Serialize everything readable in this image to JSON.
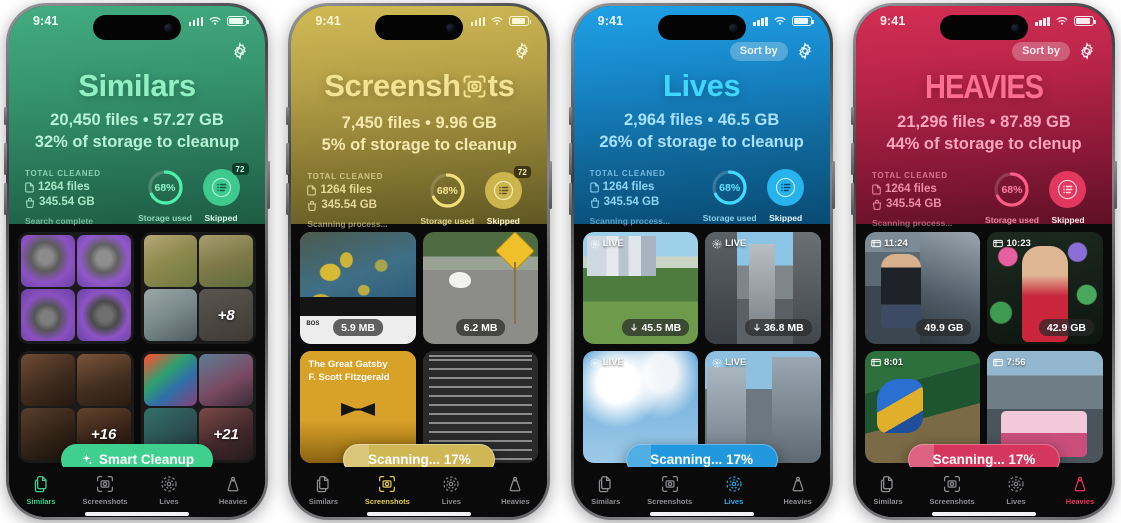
{
  "colors": {
    "green_light": "#3fab7f",
    "green_dark": "#1b5740",
    "gold_light": "#cdb64f",
    "gold_dark": "#6e6326",
    "blue_light": "#1e9ee0",
    "blue_dark": "#0b4f78",
    "red_light": "#d42c52",
    "red_dark": "#7e1430",
    "accent_green": "#34c88a",
    "accent_gold": "#e8d56a",
    "accent_blue": "#2ec5f6",
    "accent_red": "#ff5e86",
    "tab_inactive": "#8e8e93"
  },
  "status_bar": {
    "time": "9:41",
    "signal": "cellular-signal",
    "wifi": "wifi",
    "battery": "battery"
  },
  "tabs": [
    {
      "label": "Similars",
      "icon": "documents-icon"
    },
    {
      "label": "Screenshots",
      "icon": "screenshot-frame-icon"
    },
    {
      "label": "Lives",
      "icon": "live-photo-icon"
    },
    {
      "label": "Heavies",
      "icon": "weight-icon"
    }
  ],
  "common": {
    "kicker": "TOTAL CLEANED",
    "files_cleaned": "1264 files",
    "size_cleaned": "345.54 GB",
    "storage_caption": "Storage used",
    "skipped_caption": "Skipped",
    "storage_percent": "68%",
    "storage_percent_value": 68,
    "skipped_badge": "72",
    "sort_by_label": "Sort by",
    "settings_icon": "gear-icon",
    "file-icon": "file-icon",
    "bag-icon": "cleanup-bag-icon"
  },
  "screens": [
    {
      "id": "similars",
      "title": "Similars",
      "title_style": "plain",
      "stats_line": "20,450 files • 57.27 GB",
      "cleanup_line": "32% of storage to cleanup",
      "left_caption": "Search complete",
      "has_sort_by": false,
      "has_skipped_badge": true,
      "active_tab": 0,
      "action": {
        "label": "Smart Cleanup",
        "icon": "sparkle-icon",
        "type": "button",
        "progress": 0
      },
      "card_type": "quad",
      "cards": [
        {
          "overflow": "",
          "tiles": [
            "#7b4fae",
            "#7e52b1",
            "#6e4aa0",
            "#8457b8"
          ]
        },
        {
          "overflow": "+8",
          "tiles": [
            "#8a7b4a",
            "#7d6f44",
            "#6f7d80",
            "#4a4640"
          ]
        },
        {
          "overflow": "+16",
          "tiles": [
            "#5c3a2c",
            "#6b4536",
            "#4a3024",
            "#56382a"
          ]
        },
        {
          "overflow": "+21",
          "tiles": [
            "#2f7a6a",
            "#7a4a68",
            "#3a6a72",
            "#6b3a52"
          ]
        }
      ]
    },
    {
      "id": "screenshots",
      "title": "Screensh",
      "title_suffix": "ts",
      "title_style": "camera-o",
      "stats_line": "7,450 files • 9.96 GB",
      "cleanup_line": "5% of storage to cleanup",
      "left_caption": "Scanning process...",
      "has_sort_by": false,
      "has_skipped_badge": true,
      "active_tab": 1,
      "action": {
        "label": "Scanning... 17%",
        "icon": "",
        "type": "progress",
        "progress": 17
      },
      "card_type": "screenshot",
      "cards": [
        {
          "size": "5.9 MB",
          "kind": "flight-map-screenshot"
        },
        {
          "size": "6.2 MB",
          "kind": "duck-crossing-sign-photo"
        },
        {
          "size": "",
          "kind": "book-cover-great-gatsby"
        },
        {
          "size": "",
          "kind": "text-page-screenshot"
        }
      ]
    },
    {
      "id": "lives",
      "title": "Lives",
      "title_style": "plain",
      "stats_line": "2,964 files • 46.5 GB",
      "cleanup_line": "26% of storage to cleanup",
      "left_caption": "Scanning process...",
      "has_sort_by": true,
      "has_skipped_badge": false,
      "active_tab": 2,
      "action": {
        "label": "Scanning... 17%",
        "icon": "",
        "type": "progress",
        "progress": 17
      },
      "card_type": "live",
      "cards": [
        {
          "size": "45.5 MB",
          "tag": "LIVE",
          "kind": "central-park-skyline"
        },
        {
          "size": "36.8 MB",
          "tag": "LIVE",
          "kind": "manhattan-bridge"
        },
        {
          "size": "",
          "tag": "LIVE",
          "kind": "cloudy-sky"
        },
        {
          "size": "",
          "tag": "LIVE",
          "kind": "city-buildings"
        }
      ]
    },
    {
      "id": "heavies",
      "title": "HEAVIES",
      "title_style": "condensed",
      "stats_line": "21,296 files • 87.89 GB",
      "cleanup_line": "44% of storage to clenup",
      "left_caption": "Scanning process...",
      "has_sort_by": true,
      "has_skipped_badge": false,
      "active_tab": 3,
      "action": {
        "label": "Scanning... 17%",
        "icon": "",
        "type": "progress",
        "progress": 17
      },
      "card_type": "video",
      "cards": [
        {
          "size": "49.9 GB",
          "time": "11:24",
          "kind": "woman-city-street-video"
        },
        {
          "size": "42.9 GB",
          "time": "10:23",
          "kind": "woman-floral-wall-video"
        },
        {
          "size": "",
          "time": "8:01",
          "kind": "parrot-palm-video"
        },
        {
          "size": "",
          "time": "7:56",
          "kind": "food-truck-video"
        }
      ]
    }
  ]
}
